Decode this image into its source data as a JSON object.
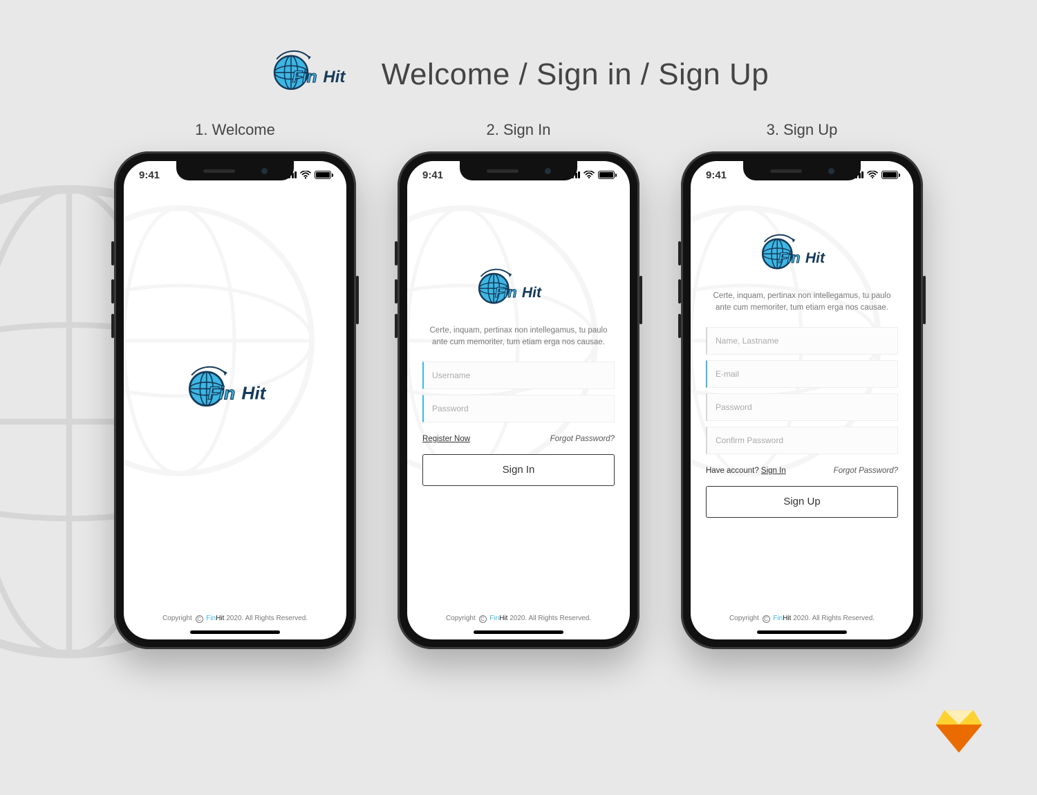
{
  "brand": {
    "fin": "Fin",
    "hit": "Hit"
  },
  "header": {
    "title": "Welcome / Sign in / Sign Up"
  },
  "labels": {
    "welcome": "1. Welcome",
    "signin": "2. Sign In",
    "signup": "3. Sign Up"
  },
  "status": {
    "time": "9:41"
  },
  "blurb": "Certe, inquam, pertinax non intellegamus, tu paulo ante cum memoriter, tum etiam erga nos causae.",
  "signin": {
    "fields": {
      "username": "Username",
      "password": "Password"
    },
    "register": "Register Now",
    "forgot": "Forgot Password?",
    "button": "Sign In"
  },
  "signup": {
    "fields": {
      "name": "Name, Lastname",
      "email": "E-mail",
      "password": "Password",
      "confirm": "Confirm Password"
    },
    "have_account_prefix": "Have account? ",
    "have_account_link": "Sign In",
    "forgot": "Forgot Password?",
    "button": "Sign Up"
  },
  "footer": {
    "prefix": "Copyright ",
    "c": "C",
    "suffix": " 2020. All Rights Reserved."
  },
  "colors": {
    "accent": "#3db7e4",
    "text": "#333"
  }
}
